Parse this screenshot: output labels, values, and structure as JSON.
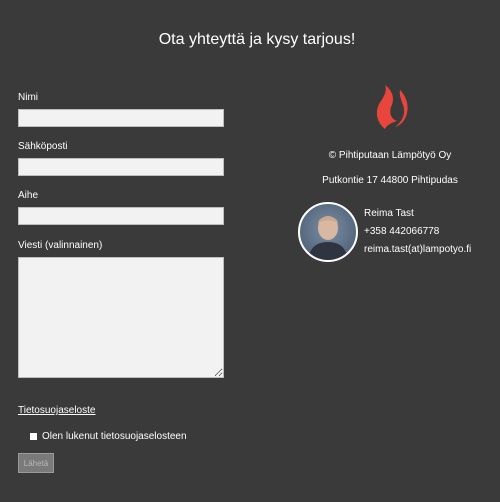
{
  "page": {
    "title": "Ota yhteyttä ja kysy tarjous!"
  },
  "form": {
    "name_label": "Nimi",
    "email_label": "Sähköposti",
    "subject_label": "Aihe",
    "message_label": "Viesti (valinnainen)",
    "name_value": "",
    "email_value": "",
    "subject_value": "",
    "message_value": "",
    "privacy_link": "Tietosuojaseloste",
    "consent_label": "Olen lukenut tietosuojaselosteen",
    "consent_checked": false,
    "submit_label": "Lähetä"
  },
  "info": {
    "logo_icon": "flame-icon",
    "company": "© Pihtiputaan Lämpötyö Oy",
    "address": "Putkontie 17 44800 Pihtipudas",
    "contact": {
      "name": "Reima Tast",
      "phone": "+358 442066778",
      "email": "reima.tast(at)lampotyo.fi"
    }
  },
  "colors": {
    "background": "#3a3a3a",
    "text": "#ffffff",
    "flame": "#e8463c"
  }
}
